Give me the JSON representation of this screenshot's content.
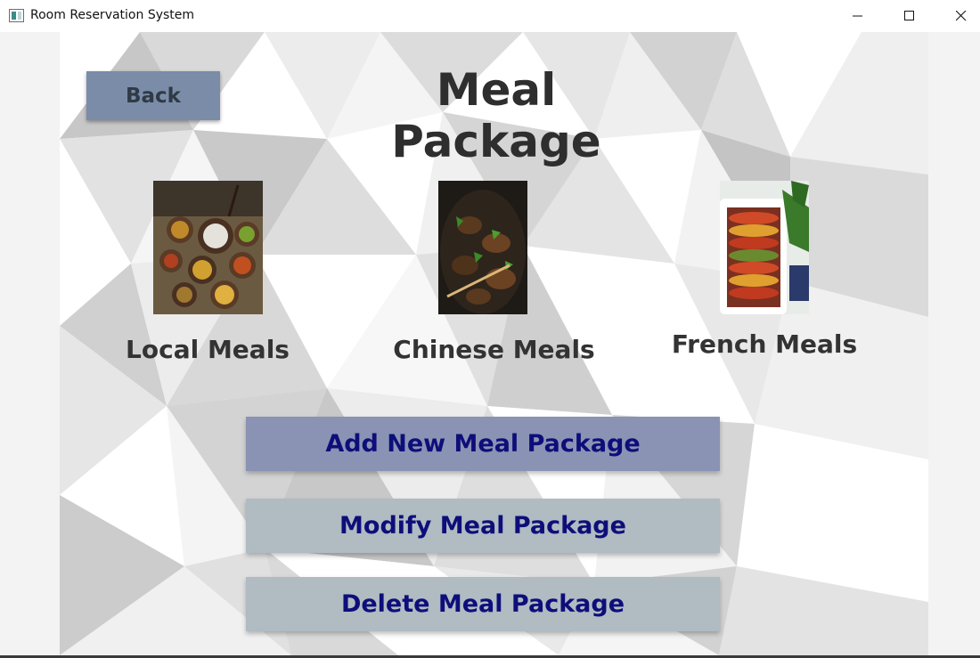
{
  "window": {
    "title": "Room Reservation System",
    "icons": {
      "app": "window-app-icon",
      "minimize": "minimize-icon",
      "maximize": "maximize-icon",
      "close": "close-icon"
    }
  },
  "page": {
    "title": "Meal Package",
    "back_label": "Back"
  },
  "meals": [
    {
      "label": "Local Meals",
      "image": "local-meals-photo"
    },
    {
      "label": "Chinese Meals",
      "image": "chinese-meals-photo"
    },
    {
      "label": "French Meals",
      "image": "french-meals-photo"
    }
  ],
  "actions": {
    "add_label": "Add New Meal Package",
    "modify_label": "Modify Meal Package",
    "delete_label": "Delete Meal Package"
  },
  "colors": {
    "back_button": "#7a8ca8",
    "add_button": "#8a93b4",
    "secondary_button": "#b0bbc2",
    "button_text": "#0e0e7a",
    "heading_text": "#2e2e2e"
  }
}
